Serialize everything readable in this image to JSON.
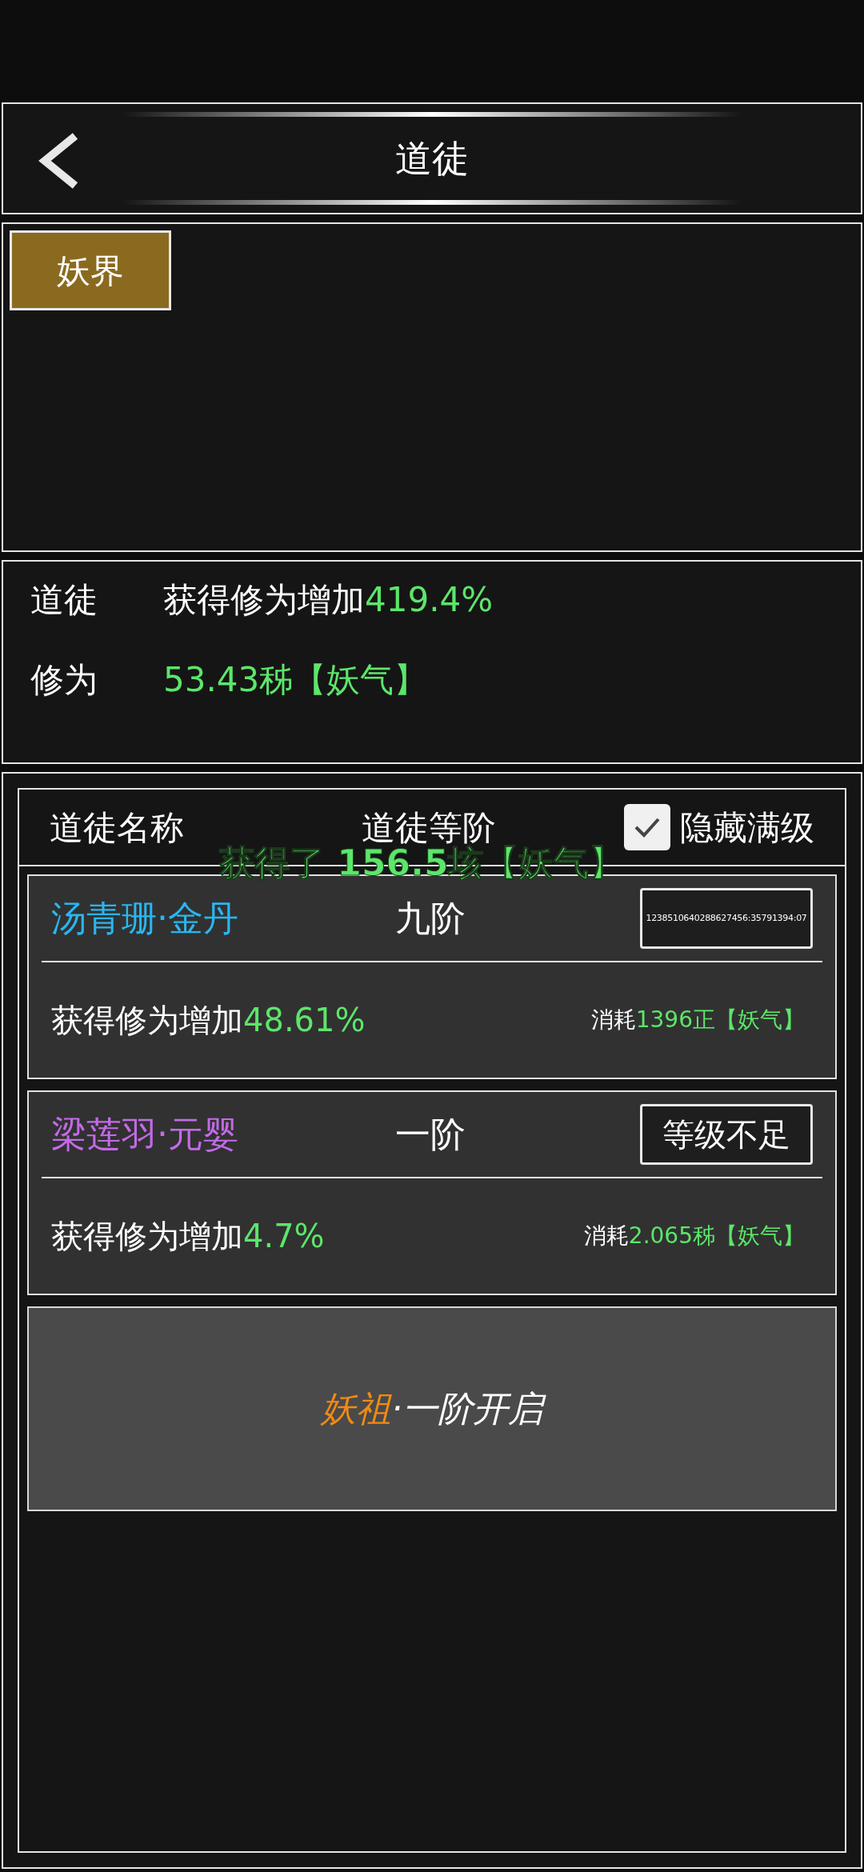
{
  "header": {
    "title": "道徒"
  },
  "tabs": [
    {
      "label": "妖界",
      "selected": true
    }
  ],
  "stats": [
    {
      "label": "道徒",
      "text": "获得修为增加",
      "value": "419.4%"
    },
    {
      "label": "修为",
      "value": "53.43秭【妖气】"
    }
  ],
  "list": {
    "columns": [
      "道徒名称",
      "道徒等阶"
    ],
    "hide_maxed": {
      "label": "隐藏满级",
      "checked": true
    },
    "disciples": [
      {
        "name": "汤青珊·金丹",
        "color": "#29b6f0",
        "rank": "九阶",
        "action": {
          "kind": "timer",
          "label": "1238510640288627456:35791394:07"
        },
        "bonus_text": "获得修为增加",
        "bonus_value": "48.61%",
        "cost_text": "消耗",
        "cost_value": "1396正【妖气】"
      },
      {
        "name": "梁莲羽·元婴",
        "color": "#c36ae8",
        "rank": "一阶",
        "action": {
          "kind": "button",
          "label": "等级不足"
        },
        "bonus_text": "获得修为增加",
        "bonus_value": "4.7%",
        "cost_text": "消耗",
        "cost_value": "2.065秭【妖气】"
      }
    ],
    "unlock": {
      "highlight": "妖祖",
      "text": "·一阶开启"
    }
  },
  "toast": "获得了 156.5垓【妖气】"
}
